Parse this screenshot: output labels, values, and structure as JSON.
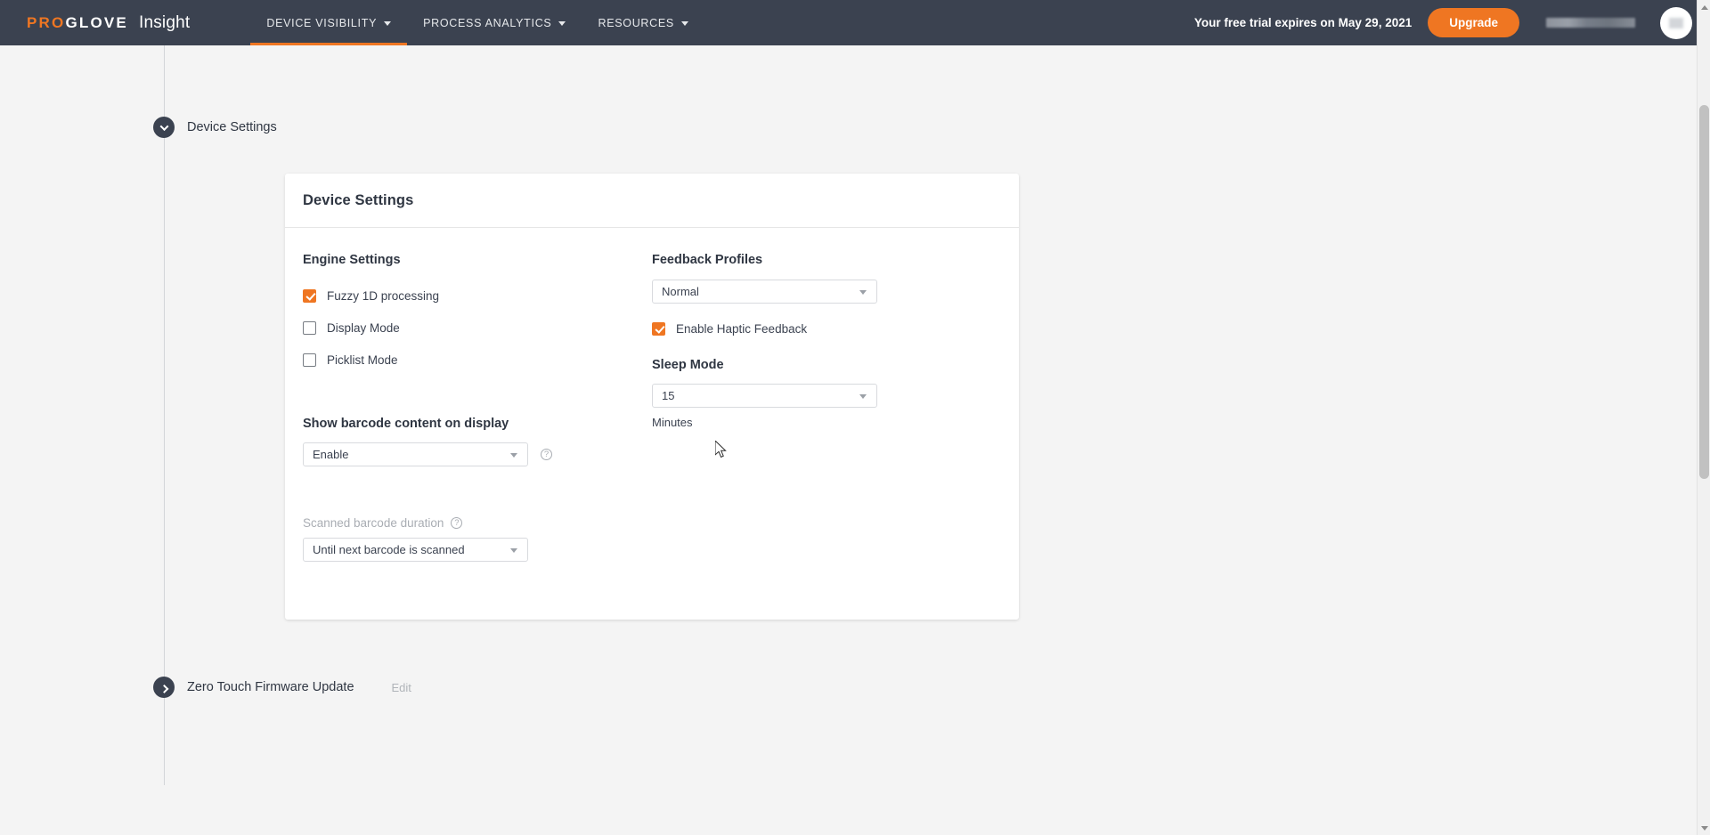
{
  "header": {
    "brand": {
      "pro": "PRO",
      "glove": "GLOVE",
      "product": "Insight"
    },
    "nav": [
      {
        "label": "DEVICE VISIBILITY",
        "active": true
      },
      {
        "label": "PROCESS ANALYTICS",
        "active": false
      },
      {
        "label": "RESOURCES",
        "active": false
      }
    ],
    "trial_notice": "Your free trial expires on May 29, 2021",
    "upgrade_label": "Upgrade",
    "accent_color": "#ef7622",
    "bar_color": "#3b4250"
  },
  "sections": [
    {
      "title": "Device Settings",
      "expanded": true,
      "edit_label": ""
    },
    {
      "title": "Zero Touch Firmware Update",
      "expanded": false,
      "edit_label": "Edit"
    }
  ],
  "card": {
    "title": "Device Settings",
    "engine": {
      "title": "Engine Settings",
      "checkboxes": [
        {
          "label": "Fuzzy 1D processing",
          "checked": true
        },
        {
          "label": "Display Mode",
          "checked": false
        },
        {
          "label": "Picklist Mode",
          "checked": false
        }
      ]
    },
    "feedback": {
      "title": "Feedback Profiles",
      "select_value": "Normal",
      "haptic": {
        "label": "Enable Haptic Feedback",
        "checked": true
      }
    },
    "sleep": {
      "title": "Sleep Mode",
      "select_value": "15",
      "unit_label": "Minutes"
    },
    "barcode_display": {
      "title": "Show barcode content on display",
      "select_value": "Enable",
      "help_icon_glyph": "?"
    },
    "scanned_duration": {
      "title": "Scanned barcode duration",
      "select_value": "Until next barcode is scanned",
      "help_icon_glyph": "?",
      "disabled": true
    }
  }
}
